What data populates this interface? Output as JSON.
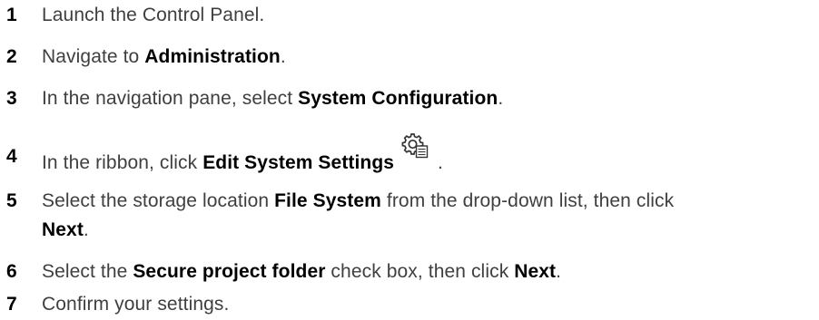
{
  "steps": [
    {
      "number": "1",
      "segments": [
        "Launch the Control Panel."
      ]
    },
    {
      "number": "2",
      "segments": [
        "Navigate to ",
        "Administration",
        "."
      ]
    },
    {
      "number": "3",
      "segments": [
        "In the navigation pane, select ",
        "System Configuration",
        "."
      ]
    },
    {
      "number": "4",
      "segments": [
        "In the ribbon, click ",
        "Edit System Settings",
        " ."
      ],
      "icon": "gear-document-icon"
    },
    {
      "number": "5",
      "segments": [
        "Select the storage location ",
        "File System",
        " from the drop-down list, then click"
      ],
      "continuation": [
        "Next",
        "."
      ]
    },
    {
      "number": "6",
      "segments": [
        "Select the ",
        "Secure project folder",
        " check box, then click ",
        "Next",
        "."
      ]
    },
    {
      "number": "7",
      "segments": [
        "Confirm your settings."
      ]
    }
  ]
}
